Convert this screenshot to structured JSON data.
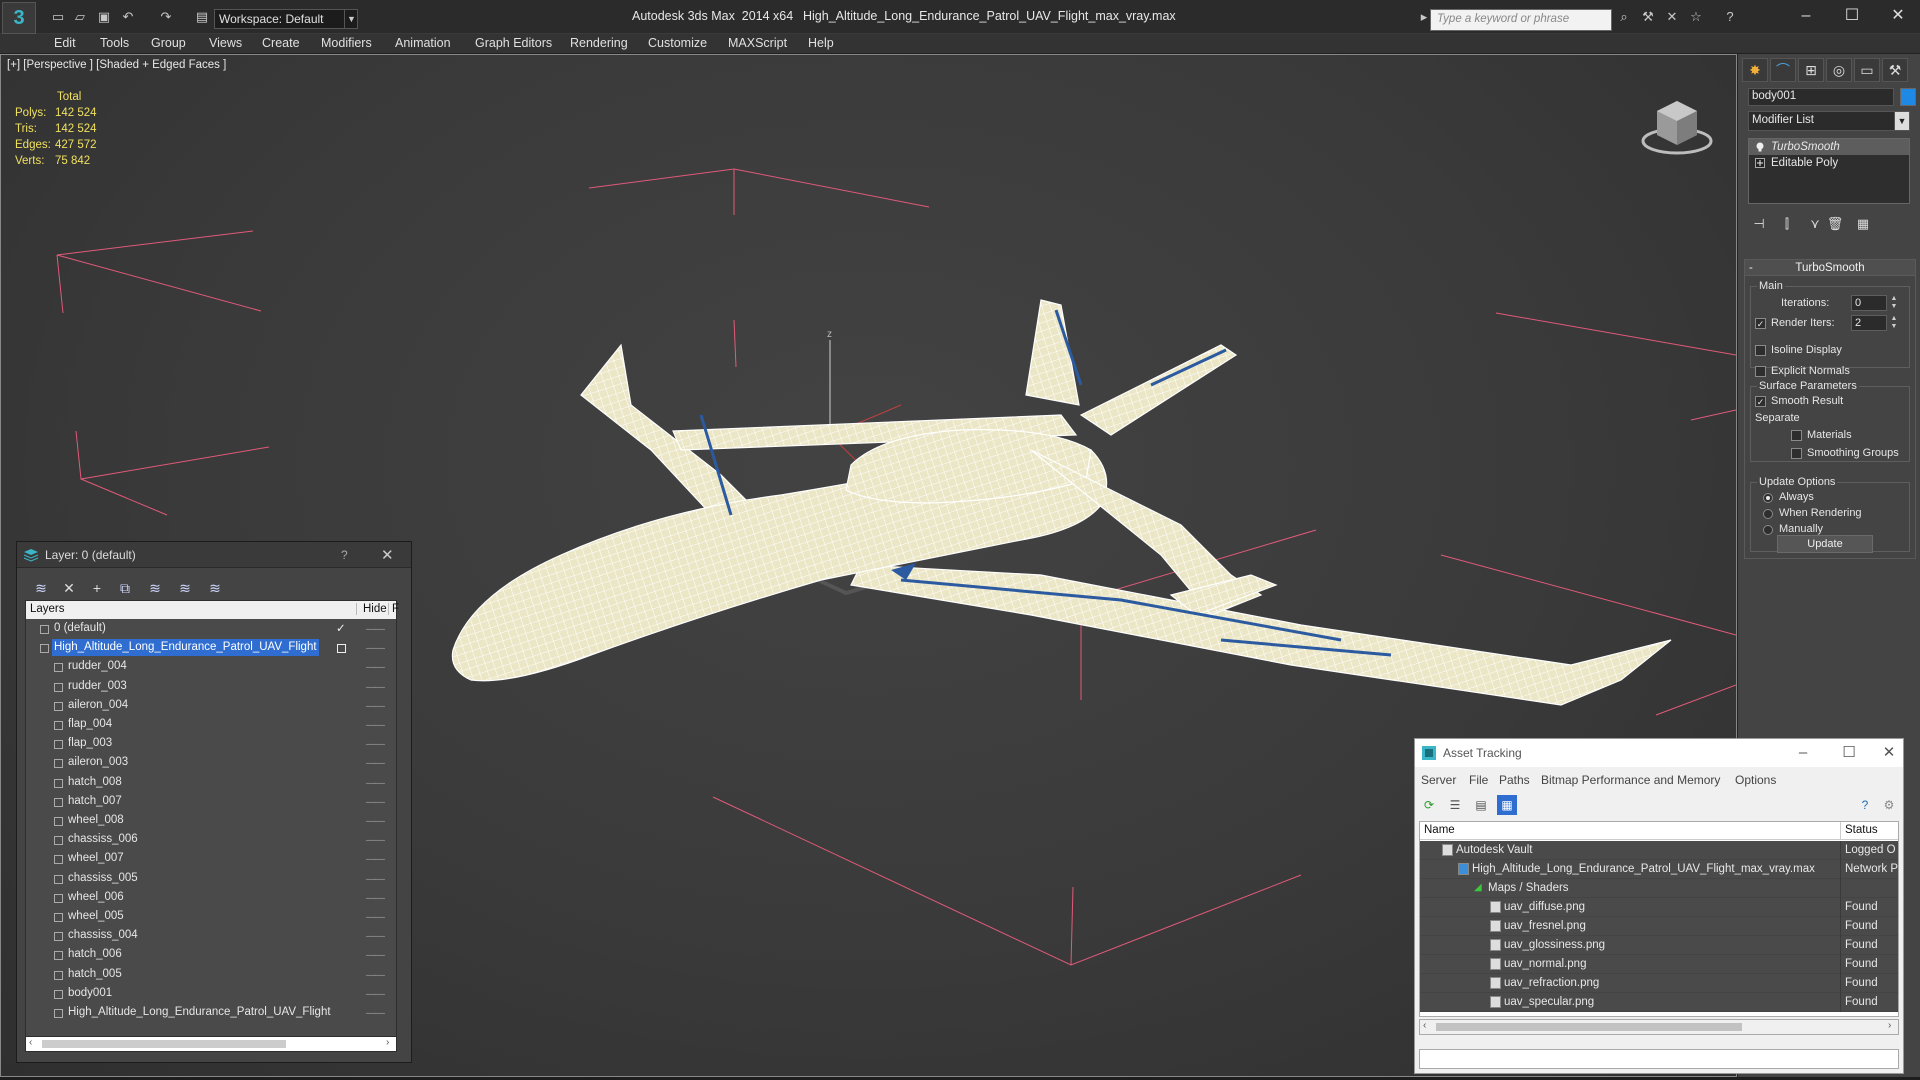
{
  "titlebar": {
    "app_title": "Autodesk 3ds Max  2014 x64",
    "file_name": "High_Altitude_Long_Endurance_Patrol_UAV_Flight_max_vray.max",
    "workspace": "Workspace: Default",
    "search_placeholder": "Type a keyword or phrase",
    "logo_icon": "3ds-max-logo-icon",
    "window_controls": [
      "minimize",
      "maximize",
      "close"
    ]
  },
  "menu": {
    "items": [
      "Edit",
      "Tools",
      "Group",
      "Views",
      "Create",
      "Modifiers",
      "Animation",
      "Graph Editors",
      "Rendering",
      "Customize",
      "MAXScript",
      "Help"
    ]
  },
  "viewport": {
    "label": "[+] [Perspective ] [Shaded + Edged Faces ]",
    "stats": {
      "header": "Total",
      "rows": [
        {
          "label": "Polys:",
          "value": "142 524"
        },
        {
          "label": "Tris:",
          "value": "142 524"
        },
        {
          "label": "Edges:",
          "value": "427 572"
        },
        {
          "label": "Verts:",
          "value": "75 842"
        }
      ]
    },
    "axis_label": "z"
  },
  "command_panel": {
    "object_name": "body001",
    "object_color": "#1e88e5",
    "modifier_list": "Modifier List",
    "stack": [
      {
        "label": "TurboSmooth",
        "selected": true
      },
      {
        "label": "Editable Poly",
        "selected": false
      }
    ],
    "turbosmooth": {
      "title": "TurboSmooth",
      "main_group": "Main",
      "iterations_label": "Iterations:",
      "iterations_value": "0",
      "render_iters_label": "Render Iters:",
      "render_iters_value": "2",
      "render_iters_checked": true,
      "isoline_label": "Isoline Display",
      "explicit_normals_label": "Explicit Normals",
      "surface_group": "Surface Parameters",
      "smooth_result_label": "Smooth Result",
      "smooth_result_checked": true,
      "separate_label": "Separate",
      "materials_label": "Materials",
      "smoothing_groups_label": "Smoothing Groups",
      "update_group": "Update Options",
      "always_label": "Always",
      "when_rendering_label": "When Rendering",
      "manually_label": "Manually",
      "update_button": "Update"
    }
  },
  "layer_panel": {
    "title": "Layer: 0 (default)",
    "help": "?",
    "col_layers": "Layers",
    "col_hide": "Hide",
    "col_f": "F",
    "rows": [
      {
        "name": "0 (default)",
        "indent": 1,
        "check": true,
        "selected": false
      },
      {
        "name": "High_Altitude_Long_Endurance_Patrol_UAV_Flight",
        "indent": 1,
        "check": false,
        "selected": true
      },
      {
        "name": "rudder_004",
        "indent": 2
      },
      {
        "name": "rudder_003",
        "indent": 2
      },
      {
        "name": "aileron_004",
        "indent": 2
      },
      {
        "name": "flap_004",
        "indent": 2
      },
      {
        "name": "flap_003",
        "indent": 2
      },
      {
        "name": "aileron_003",
        "indent": 2
      },
      {
        "name": "hatch_008",
        "indent": 2
      },
      {
        "name": "hatch_007",
        "indent": 2
      },
      {
        "name": "wheel_008",
        "indent": 2
      },
      {
        "name": "chassiss_006",
        "indent": 2
      },
      {
        "name": "wheel_007",
        "indent": 2
      },
      {
        "name": "chassiss_005",
        "indent": 2
      },
      {
        "name": "wheel_006",
        "indent": 2
      },
      {
        "name": "wheel_005",
        "indent": 2
      },
      {
        "name": "chassiss_004",
        "indent": 2
      },
      {
        "name": "hatch_006",
        "indent": 2
      },
      {
        "name": "hatch_005",
        "indent": 2
      },
      {
        "name": "body001",
        "indent": 2
      },
      {
        "name": "High_Altitude_Long_Endurance_Patrol_UAV_Flight",
        "indent": 2
      }
    ]
  },
  "asset_tracking": {
    "title": "Asset Tracking",
    "menu": [
      "Server",
      "File",
      "Paths",
      "Bitmap Performance and Memory",
      "Options"
    ],
    "col_name": "Name",
    "col_status": "Status",
    "rows": [
      {
        "name": "Autodesk Vault",
        "status": "Logged O",
        "indent": 0
      },
      {
        "name": "High_Altitude_Long_Endurance_Patrol_UAV_Flight_max_vray.max",
        "status": "Network P",
        "indent": 1
      },
      {
        "name": "Maps / Shaders",
        "status": "",
        "indent": 2
      },
      {
        "name": "uav_diffuse.png",
        "status": "Found",
        "indent": 3
      },
      {
        "name": "uav_fresnel.png",
        "status": "Found",
        "indent": 3
      },
      {
        "name": "uav_glossiness.png",
        "status": "Found",
        "indent": 3
      },
      {
        "name": "uav_normal.png",
        "status": "Found",
        "indent": 3
      },
      {
        "name": "uav_refraction.png",
        "status": "Found",
        "indent": 3
      },
      {
        "name": "uav_specular.png",
        "status": "Found",
        "indent": 3
      }
    ]
  }
}
